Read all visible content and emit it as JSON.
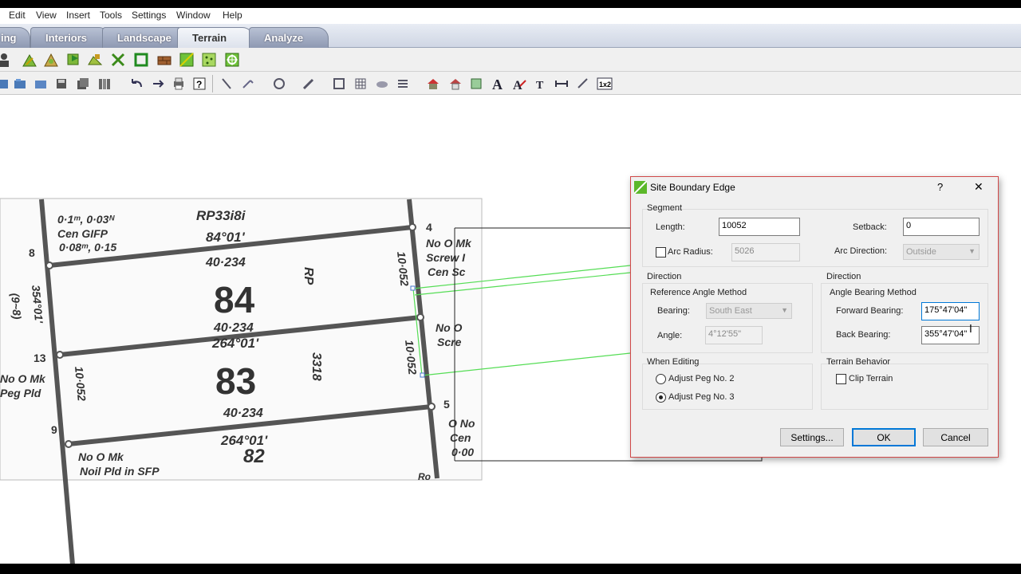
{
  "menu": [
    "Edit",
    "View",
    "Insert",
    "Tools",
    "Settings",
    "Window",
    "Help"
  ],
  "tabs": [
    {
      "label": "ing",
      "active": false
    },
    {
      "label": "Interiors",
      "active": false
    },
    {
      "label": "Landscape",
      "active": false
    },
    {
      "label": "Terrain",
      "active": true
    },
    {
      "label": "Analyze",
      "active": false
    }
  ],
  "survey": {
    "lots": [
      "84",
      "83",
      "82"
    ],
    "text": {
      "rp": "RP",
      "rp33181": "RP33i8i",
      "brg1": "84°01'",
      "brg2": "264°01'",
      "brg3": "264°01'",
      "len1": "40·234",
      "len2": "40·234",
      "len3": "40·234",
      "num8": "8",
      "num4": "4",
      "num13": "13",
      "num5": "5",
      "num9": "9",
      "cen1": "Cen GIFP",
      "cen2": "0·1ᵐ, 0·03ᴺ",
      "cen3": "0·08ᵐ, 0·15",
      "no_o_mk1": "No O Mk",
      "no_o_mk2": "No O Mk",
      "noil": "Noil Pld in SFP",
      "screw": "Screw I",
      "no_o": "No O",
      "scre": "Scre",
      "peg": "Peg Pld",
      "rect": "3318",
      "v10052a": "10·052",
      "v10052b": "10·052",
      "v10052c": "10·052",
      "v354": "354°01'",
      "v9_8": "(9~8)",
      "onc": "O No",
      "cen_right": "Cen",
      "o_00": "0·00",
      "no_o_mk_r": "No O Mk",
      "ro": "Ro",
      "cen_sc": "Cen Sc",
      "no_o_left": "No O Mk"
    }
  },
  "dialog": {
    "title": "Site Boundary Edge",
    "help": "?",
    "close": "✕",
    "segment": {
      "label": "Segment",
      "length_label": "Length:",
      "length_value": "10052",
      "setback_label": "Setback:",
      "setback_value": "0",
      "arc_radius_label": "Arc Radius:",
      "arc_radius_value": "5026",
      "arc_direction_label": "Arc Direction:",
      "arc_direction_value": "Outside"
    },
    "direction_left": {
      "label": "Direction",
      "method": "Reference Angle Method",
      "bearing_label": "Bearing:",
      "bearing_value": "South East",
      "angle_label": "Angle:",
      "angle_value": "4°12'55\""
    },
    "direction_right": {
      "label": "Direction",
      "method": "Angle Bearing Method",
      "forward_label": "Forward Bearing:",
      "forward_value": "175°47'04\"",
      "back_label": "Back Bearing:",
      "back_value": "355°47'04\""
    },
    "when_editing": {
      "label": "When Editing",
      "opt2": "Adjust Peg No. 2",
      "opt3": "Adjust Peg No. 3"
    },
    "terrain": {
      "label": "Terrain Behavior",
      "clip": "Clip Terrain"
    },
    "buttons": {
      "settings": "Settings...",
      "ok": "OK",
      "cancel": "Cancel"
    }
  }
}
